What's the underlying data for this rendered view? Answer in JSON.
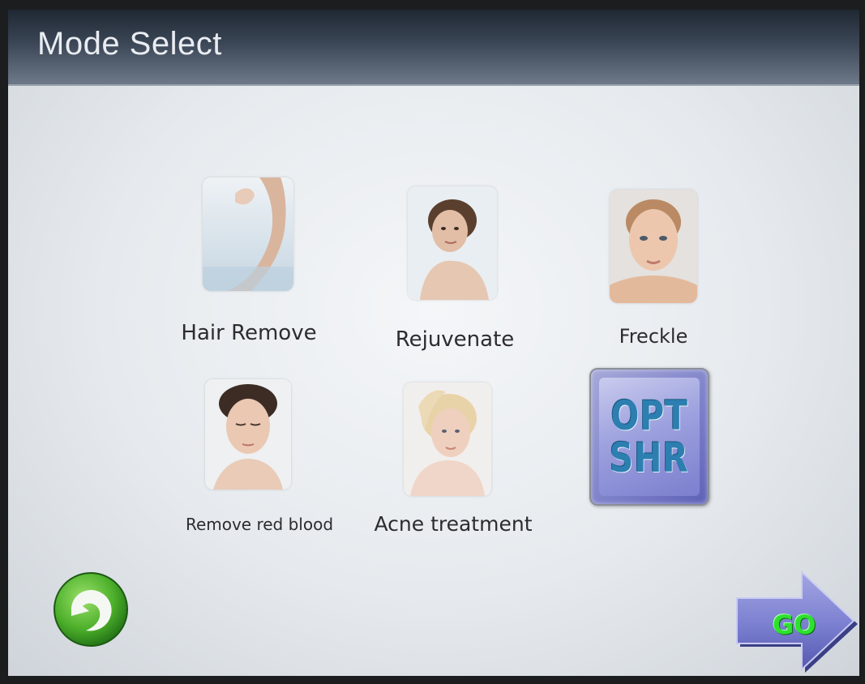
{
  "header": {
    "title": "Mode Select"
  },
  "modes": [
    {
      "label": "Hair Remove",
      "icon": "leg-photo-icon"
    },
    {
      "label": "Rejuvenate",
      "icon": "woman-portrait-icon"
    },
    {
      "label": "Freckle",
      "icon": "face-closeup-icon"
    },
    {
      "label": "Remove red blood",
      "icon": "relaxed-face-icon"
    },
    {
      "label": "Acne treatment",
      "icon": "blonde-woman-icon"
    }
  ],
  "opt_button": {
    "line1": "OPT",
    "line2": "SHR"
  },
  "nav": {
    "back_icon": "back-arrow-icon",
    "go_label": "GO"
  },
  "colors": {
    "title_text": "#e9edf2",
    "screen_bg": "#eceff2",
    "back_green": "#4caf2a",
    "go_arrow": "#7b7fd0",
    "go_text": "#2fe12f",
    "opt_text": "#2c7fb0"
  }
}
